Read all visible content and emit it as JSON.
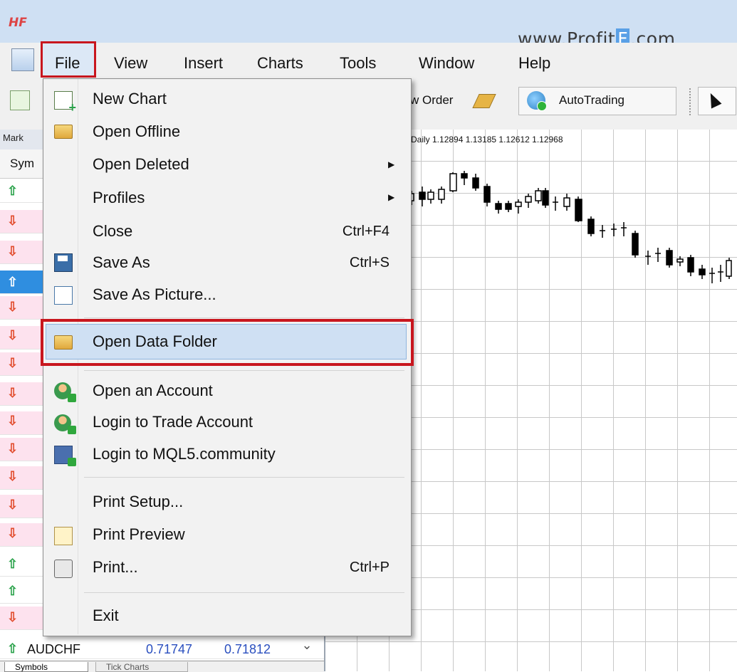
{
  "app": {
    "logo": "HF",
    "watermark_pre": "www.Profit",
    "watermark_f": "F",
    "watermark_post": ".com"
  },
  "menubar": {
    "items": [
      "File",
      "View",
      "Insert",
      "Charts",
      "Tools",
      "Window",
      "Help"
    ]
  },
  "toolbar": {
    "order_label": "w Order",
    "autotrading_label": "AutoTrading"
  },
  "market_watch": {
    "title": "Mark",
    "symbol_header": "Sym",
    "last_row": {
      "symbol": "AUDCHF",
      "bid": "0.71747",
      "ask": "0.71812"
    },
    "tabs": [
      "Symbols",
      "Tick Charts"
    ]
  },
  "chart": {
    "info": "Daily  1.12894 1.13185 1.12612 1.12968"
  },
  "file_menu": {
    "items": [
      {
        "label": "New Chart",
        "shortcut": "",
        "submenu": false,
        "icon": "new-chart-icon"
      },
      {
        "label": "Open Offline",
        "shortcut": "",
        "submenu": false,
        "icon": "open-offline-icon"
      },
      {
        "label": "Open Deleted",
        "shortcut": "",
        "submenu": true,
        "icon": ""
      },
      {
        "label": "Profiles",
        "shortcut": "",
        "submenu": true,
        "icon": ""
      },
      {
        "label": "Close",
        "shortcut": "Ctrl+F4",
        "submenu": false,
        "icon": ""
      },
      {
        "label": "Save As",
        "shortcut": "Ctrl+S",
        "submenu": false,
        "icon": "save-icon"
      },
      {
        "label": "Save As Picture...",
        "shortcut": "",
        "submenu": false,
        "icon": "picture-icon"
      },
      {
        "label": "Open Data Folder",
        "shortcut": "",
        "submenu": false,
        "icon": "folder-icon"
      },
      {
        "label": "Open an Account",
        "shortcut": "",
        "submenu": false,
        "icon": "open-account-icon"
      },
      {
        "label": "Login to Trade Account",
        "shortcut": "",
        "submenu": false,
        "icon": "login-account-icon"
      },
      {
        "label": "Login to MQL5.community",
        "shortcut": "",
        "submenu": false,
        "icon": "mql5-login-icon"
      },
      {
        "label": "Print Setup...",
        "shortcut": "",
        "submenu": false,
        "icon": ""
      },
      {
        "label": "Print Preview",
        "shortcut": "",
        "submenu": false,
        "icon": "print-preview-icon"
      },
      {
        "label": "Print...",
        "shortcut": "Ctrl+P",
        "submenu": false,
        "icon": "printer-icon"
      },
      {
        "label": "Exit",
        "shortcut": "",
        "submenu": false,
        "icon": ""
      }
    ]
  },
  "colors": {
    "highlight_red": "#c8161e",
    "menu_hover": "#cfe0f3",
    "up_arrow": "#2aa24a",
    "down_arrow": "#e14a2a",
    "selection_blue": "#2f8ee0"
  }
}
